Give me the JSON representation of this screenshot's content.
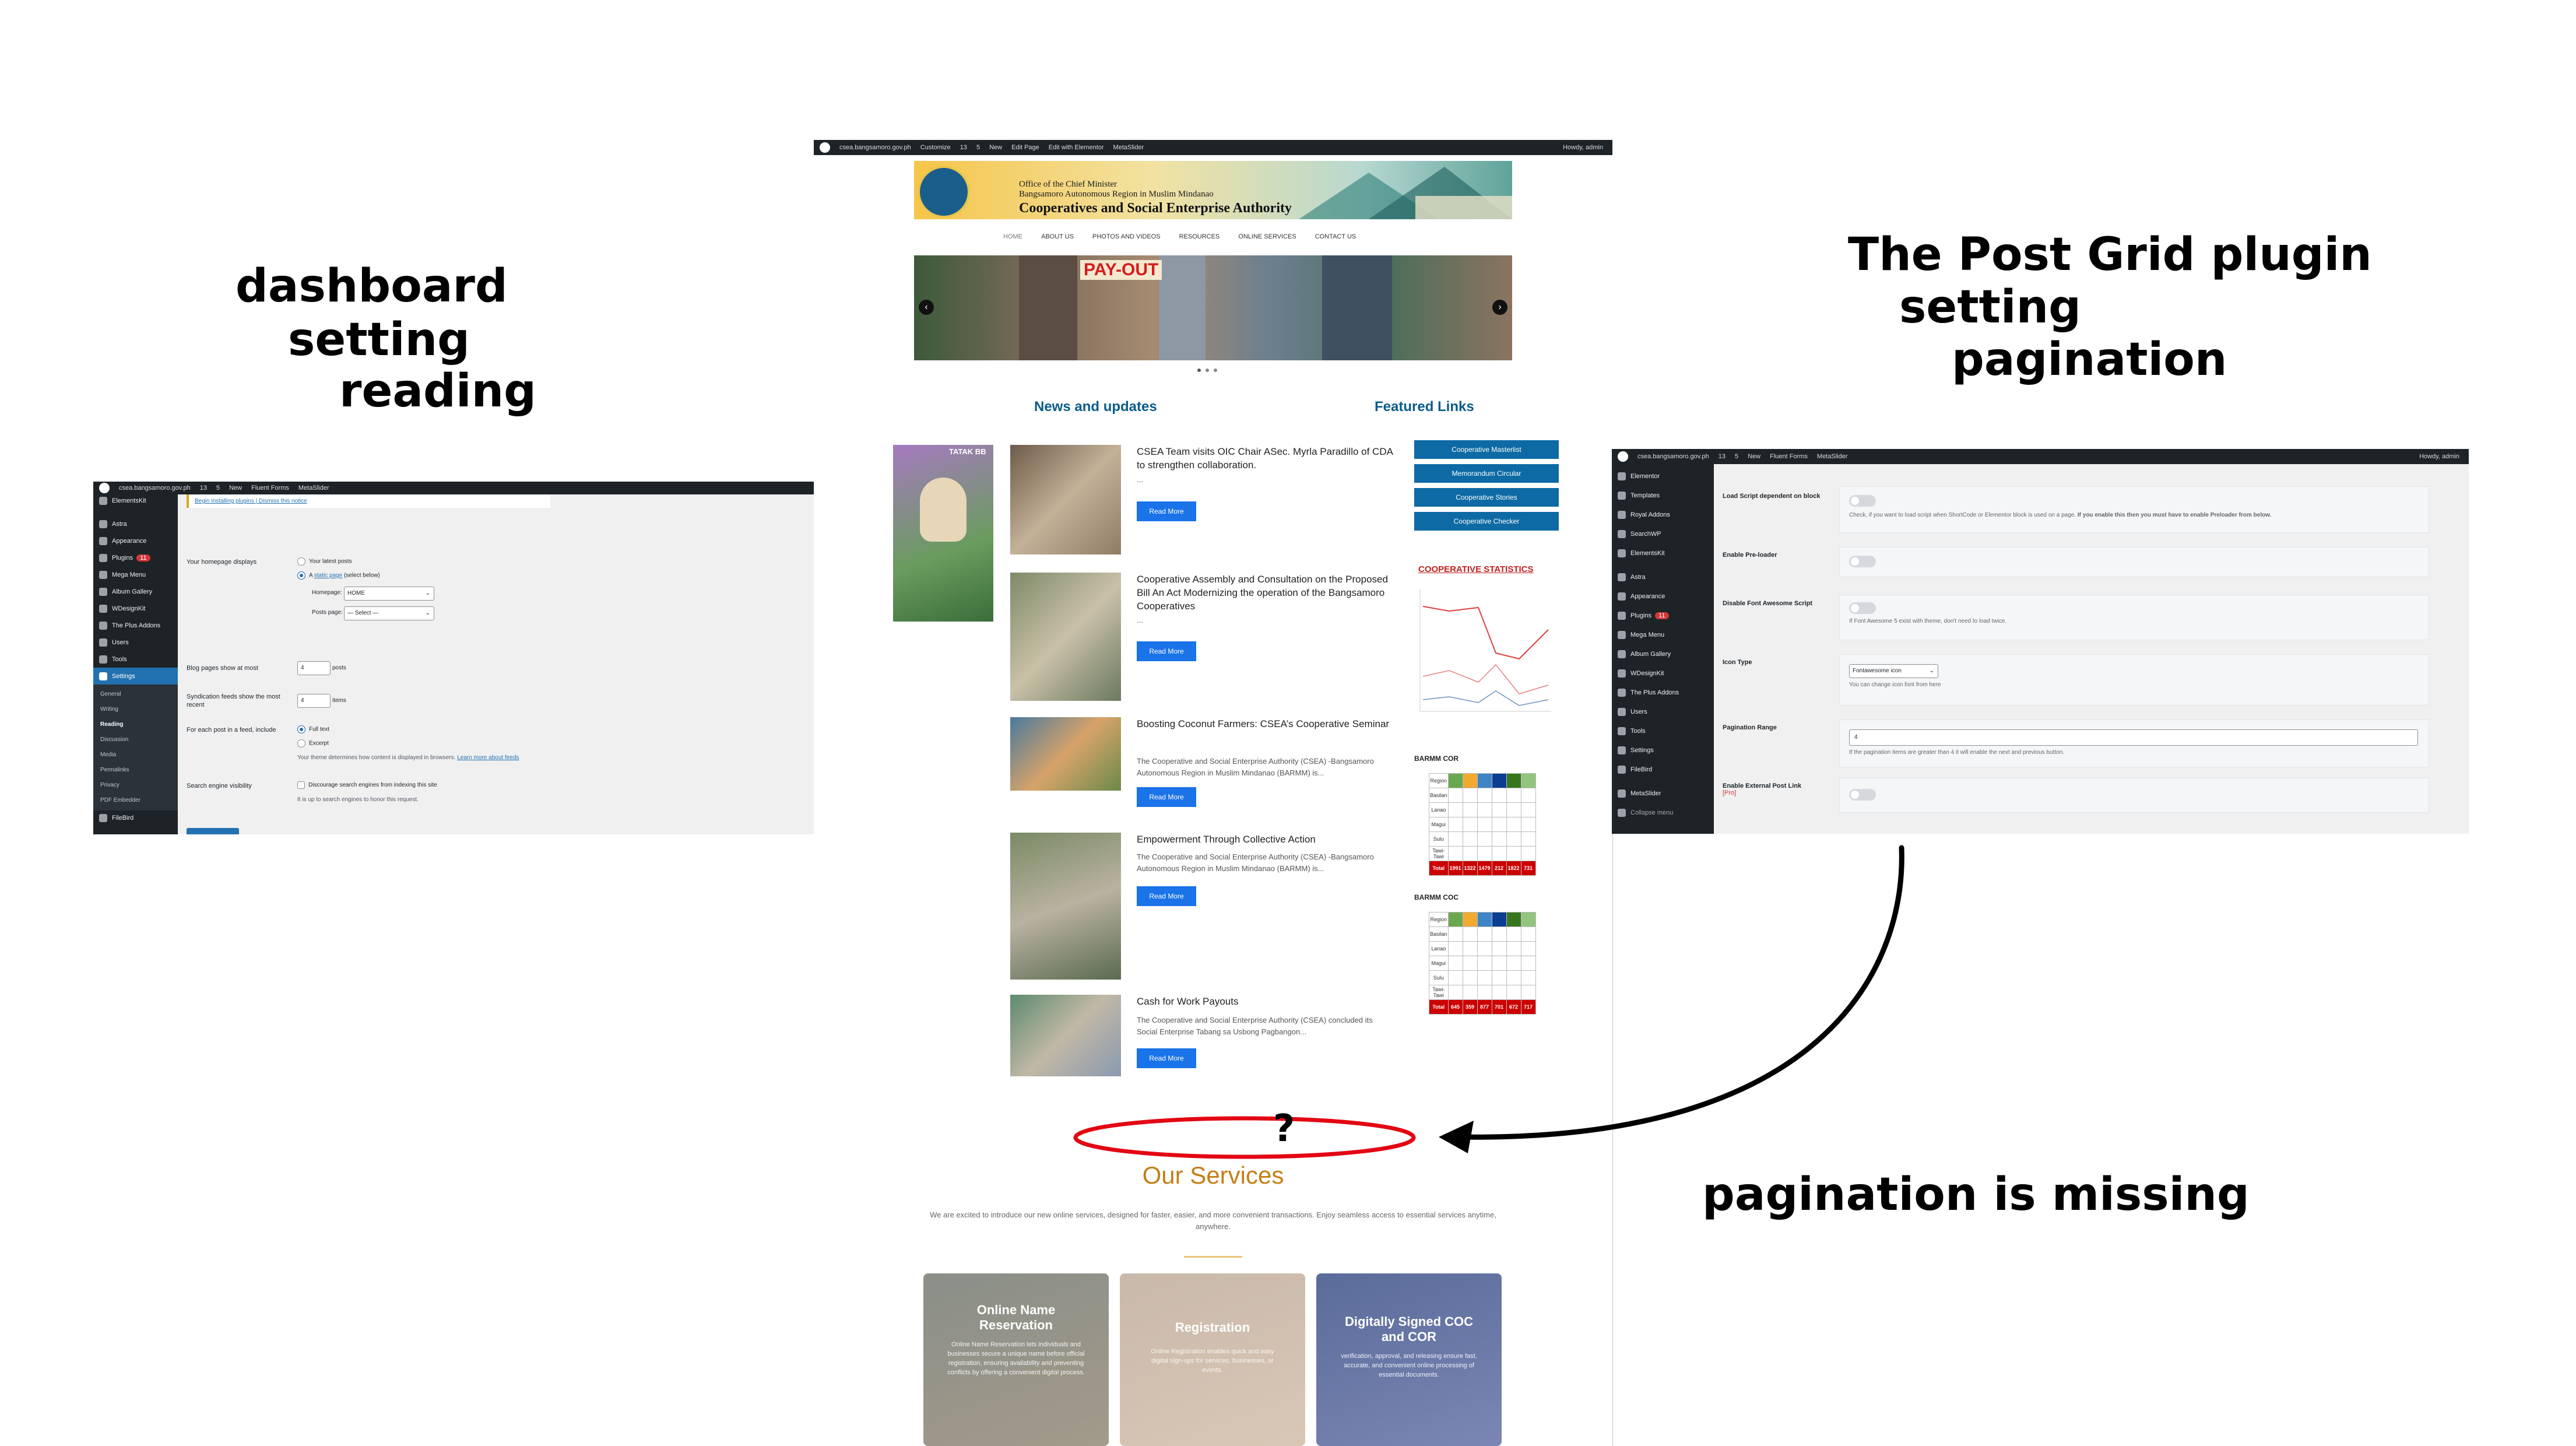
{
  "annotations": {
    "left_caption": [
      "dashboard",
      "setting",
      "reading"
    ],
    "right_caption": [
      "The Post Grid plugin",
      "setting",
      "pagination"
    ],
    "missing_caption": "pagination is missing",
    "question_mark": "?"
  },
  "left_panel": {
    "admin_bar": {
      "site": "csea.bangsamoro.gov.ph",
      "updates": "13",
      "comments": "5",
      "new": "New",
      "forms": "Fluent Forms",
      "slider": "MetaSlider"
    },
    "notice": {
      "text": "Begin installing plugins | Dismiss this notice"
    },
    "menu": [
      {
        "label": "ElementsKit"
      },
      {
        "label": "Astra"
      },
      {
        "label": "Appearance"
      },
      {
        "label": "Plugins",
        "badge": "11"
      },
      {
        "label": "Mega Menu"
      },
      {
        "label": "Album Gallery"
      },
      {
        "label": "WDesignKit"
      },
      {
        "label": "The Plus Addons"
      },
      {
        "label": "Users"
      },
      {
        "label": "Tools"
      },
      {
        "label": "Settings"
      }
    ],
    "submenu": [
      "General",
      "Writing",
      "Reading",
      "Discussion",
      "Media",
      "Permalinks",
      "Privacy",
      "PDF Embedder"
    ],
    "menu_after": "FileBird",
    "form": {
      "homepage_displays_label": "Your homepage displays",
      "opt_latest": "Your latest posts",
      "opt_static_prefix": "A",
      "opt_static_link": "static page",
      "opt_static_suffix": "(select below)",
      "homepage_label": "Homepage:",
      "homepage_value": "HOME",
      "posts_page_label": "Posts page:",
      "posts_page_value": "— Select —",
      "blog_pages_label": "Blog pages show at most",
      "blog_pages_value": "4",
      "blog_pages_unit": "posts",
      "synd_label": "Syndication feeds show the most recent",
      "synd_value": "4",
      "synd_unit": "items",
      "feed_label": "For each post in a feed, include",
      "feed_full": "Full text",
      "feed_excerpt": "Excerpt",
      "feed_note": "Your theme determines how content is displayed in browsers.",
      "feed_note_link": "Learn more about feeds",
      "search_label": "Search engine visibility",
      "search_check": "Discourage search engines from indexing this site",
      "search_note": "It is up to search engines to honor this request."
    }
  },
  "center_panel": {
    "admin_bar": {
      "site": "csea.bangsamoro.gov.ph",
      "customize": "Customize",
      "updates": "13",
      "comments": "5",
      "new": "New",
      "edit": "Edit Page",
      "elementor": "Edit with Elementor",
      "slider": "MetaSlider",
      "howdy": "Howdy, admin"
    },
    "header": {
      "line1": "Office of the Chief Minister",
      "line2": "Bangsamoro Autonomous Region in Muslim Mindanao",
      "title": "Cooperatives and Social Enterprise Authority"
    },
    "nav": [
      "HOME",
      "ABOUT US",
      "PHOTOS AND VIDEOS",
      "RESOURCES",
      "ONLINE SERVICES",
      "CONTACT US"
    ],
    "banner_text": "PAY-OUT",
    "news_heading": "News and updates",
    "featured_heading": "Featured Links",
    "side_image_label": "TATAK BB",
    "posts": [
      {
        "title": "CSEA Team visits OIC Chair ASec. Myrla Paradillo of CDA to strengthen collaboration.",
        "excerpt": "...",
        "button": "Read More"
      },
      {
        "title": "Cooperative Assembly and Consultation on the Proposed Bill An Act Modernizing the operation of the Bangsamoro Cooperatives",
        "excerpt": "...",
        "button": "Read More"
      },
      {
        "title": "Boosting Coconut Farmers: CSEA’s Cooperative Seminar",
        "excerpt": "The Cooperative and Social Enterprise Authority (CSEA) -Bangsamoro Autonomous Region in Muslim Mindanao (BARMM) is...",
        "button": "Read More"
      },
      {
        "title": "Empowerment Through Collective Action",
        "excerpt": "The Cooperative and Social Enterprise Authority (CSEA) -Bangsamoro Autonomous Region in Muslim Mindanao (BARMM) is...",
        "button": "Read More"
      },
      {
        "title": "Cash for Work Payouts",
        "excerpt": "The Cooperative and Social Enterprise Authority (CSEA) concluded its Social Enterprise Tabang sa Usbong Pagbangon...",
        "button": "Read More"
      }
    ],
    "featured_links": [
      "Cooperative Masterlist",
      "Memorandum Circular",
      "Cooperative Stories",
      "Cooperative Checker"
    ],
    "stats_heading": "COOPERATIVE STATISTICS",
    "cor_label": "BARMM COR",
    "coc_label": "BARMM COC",
    "table_rows": [
      "Region",
      "Basilan",
      "Lanao",
      "Magui",
      "Sulu",
      "Tawi-Tawi",
      "Total"
    ],
    "cor_total": [
      "Total",
      "1991",
      "1322",
      "1479",
      "212",
      "1822",
      "731"
    ],
    "coc_total": [
      "Total",
      "645",
      "359",
      "877",
      "701",
      "672",
      "717"
    ],
    "services_title": "Our Services",
    "services_desc": "We are excited to introduce our new online services, designed for faster, easier, and more convenient transactions. Enjoy seamless access to essential services anytime, anywhere.",
    "services": [
      {
        "title": "Online Name Reservation",
        "body": "Online Name Reservation lets individuals and businesses secure a unique name before official registration, ensuring availability and preventing conflicts by offering a convenient digital process."
      },
      {
        "title": "Registration",
        "body": "Online Registration enables quick and easy digital sign-ups for services, businesses, or events."
      },
      {
        "title": "Digitally Signed COC and COR",
        "body": "verification, approval, and releasing ensure fast, accurate, and convenient online processing of essential documents."
      }
    ]
  },
  "right_panel": {
    "admin_bar": {
      "site": "csea.bangsamoro.gov.ph",
      "updates": "13",
      "comments": "5",
      "new": "New",
      "forms": "Fluent Forms",
      "slider": "MetaSlider",
      "howdy": "Howdy, admin"
    },
    "menu": [
      {
        "label": "Elementor"
      },
      {
        "label": "Templates"
      },
      {
        "label": "Royal Addons"
      },
      {
        "label": "SearchWP"
      },
      {
        "label": "ElementsKit"
      },
      {
        "label": "Astra"
      },
      {
        "label": "Appearance"
      },
      {
        "label": "Plugins",
        "badge": "11"
      },
      {
        "label": "Mega Menu"
      },
      {
        "label": "Album Gallery"
      },
      {
        "label": "WDesignKit"
      },
      {
        "label": "The Plus Addons"
      },
      {
        "label": "Users"
      },
      {
        "label": "Tools"
      },
      {
        "label": "Settings"
      },
      {
        "label": "FileBird"
      },
      {
        "label": "MetaSlider"
      },
      {
        "label": "Collapse menu"
      }
    ],
    "settings": {
      "load_script_label": "Load Script dependent on block",
      "load_script_note": "Check, if you want to load script when ShortCode or Elementor block is used on a page.",
      "load_script_note_bold": "If you enable this then you must have to enable Preloader from below.",
      "preloader_label": "Enable Pre-loader",
      "fa_label": "Disable Font Awesome Script",
      "fa_note": "If Font Awesome 5 exist with theme, don't need to load twice.",
      "icon_label": "Icon Type",
      "icon_value": "Fontawesome icon",
      "icon_note": "You can change icon font from here",
      "pagination_label": "Pagination Range",
      "pagination_value": "4",
      "pagination_note": "If the pagination items are greater than 4 it will enable the next and previous button.",
      "external_label": "Enable External Post Link",
      "external_pro": "[Pro]"
    }
  },
  "colors": {
    "annotation_red": "#e30613",
    "wp_dark": "#1d2327",
    "wp_blue": "#2271b1",
    "news_blue": "#0a5c8a",
    "services_gold": "#c47f16",
    "read_more": "#1a73e8"
  }
}
